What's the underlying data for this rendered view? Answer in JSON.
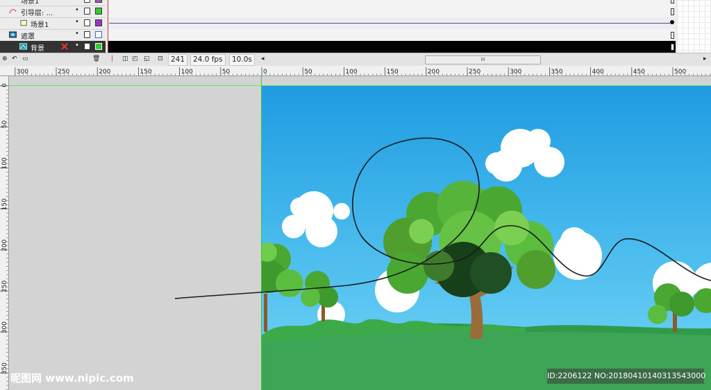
{
  "layers": [
    {
      "name": "场景1",
      "type": "folder",
      "color": "#9b59b6",
      "selected": false
    },
    {
      "name": "引导层: ...",
      "type": "guide",
      "color": "#33cc33",
      "selected": false
    },
    {
      "name": "场景1",
      "type": "layer",
      "color": "#9b33cc",
      "selected": false
    },
    {
      "name": "遮罩",
      "type": "mask",
      "color": "#ffffff",
      "selected": false
    },
    {
      "name": "背景",
      "type": "masked",
      "color": "#33cc33",
      "selected": true
    }
  ],
  "timeline": {
    "current_frame": "241",
    "fps": "24.0 fps",
    "elapsed": "10.0s",
    "scroll_grip": "III"
  },
  "ruler_top_labels": [
    "300",
    "250",
    "200",
    "150",
    "100",
    "50",
    "0",
    "50",
    "100",
    "150",
    "200",
    "250",
    "300",
    "350",
    "400",
    "450",
    "500"
  ],
  "ruler_left_labels": [
    "0",
    "50",
    "100",
    "150",
    "200",
    "250",
    "300",
    "350"
  ],
  "watermark_left": "昵图网 www.nipic.com",
  "watermark_right": "ID:2206122 NO:20180410140313543000",
  "colors": {
    "sky_top": "#1f9be0",
    "sky_bottom": "#7ad6f5",
    "grass": "#3aa84e",
    "tree_leaf": "#4aa832",
    "tree_trunk": "#9b6b3a",
    "stage_boundary": "#33cc33",
    "playhead": "#c83232"
  },
  "icons": [
    "new-layer-icon",
    "add-guide-icon",
    "new-folder-icon",
    "delete-layer-icon",
    "onion-skin-icon",
    "edit-multiple-frames-icon",
    "center-frame-icon"
  ]
}
